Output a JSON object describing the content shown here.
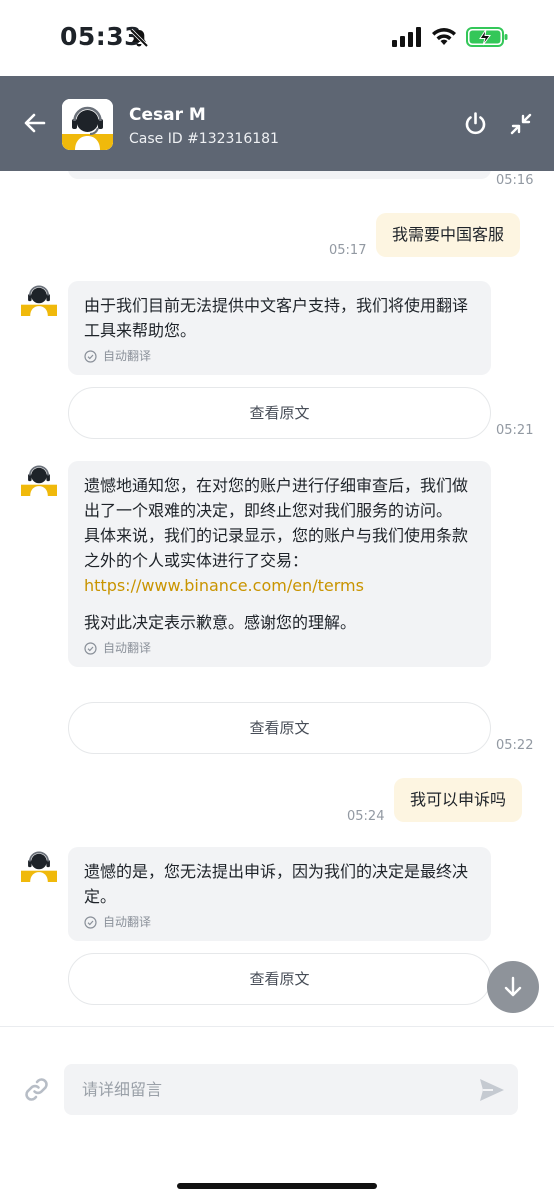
{
  "status_bar": {
    "time": "05:33",
    "battery": "charging"
  },
  "header": {
    "agent_name": "Cesar M",
    "case_id": "Case ID #132316181"
  },
  "colors": {
    "header_bg": "#5e6673",
    "user_bubble": "#fdf5e1",
    "agent_bubble": "#f2f3f5",
    "link": "#c99400"
  },
  "messages": {
    "ts_0516": "05:16",
    "user1": {
      "text": "我需要中国客服",
      "time": "05:17"
    },
    "agent1": {
      "text": "由于我们目前无法提供中文客户支持，我们将使用翻译工具来帮助您。",
      "auto_translate": "自动翻译",
      "view_original": "查看原文",
      "time": "05:21"
    },
    "agent2": {
      "line1": "遗憾地通知您，在对您的账户进行仔细审查后，我们做出了一个艰难的决定，即终止您对我们服务的访问。",
      "line2": "具体来说，我们的记录显示，您的账户与我们使用条款之外的个人或实体进行了交易：",
      "link": "https://www.binance.com/en/terms",
      "line3": "我对此决定表示歉意。感谢您的理解。",
      "auto_translate": "自动翻译",
      "view_original": "查看原文",
      "time": "05:22"
    },
    "user2": {
      "text": "我可以申诉吗",
      "time": "05:24"
    },
    "agent3": {
      "text": "遗憾的是，您无法提出申诉，因为我们的决定是最终决定。",
      "auto_translate": "自动翻译",
      "view_original": "查看原文"
    }
  },
  "composer": {
    "placeholder": "请详细留言"
  },
  "icons": [
    "back-arrow-icon",
    "power-icon",
    "minimize-icon",
    "check-circle-icon",
    "chevron-down-icon",
    "link-icon",
    "send-icon",
    "bell-slash-icon",
    "signal-icon",
    "wifi-icon",
    "battery-icon"
  ]
}
